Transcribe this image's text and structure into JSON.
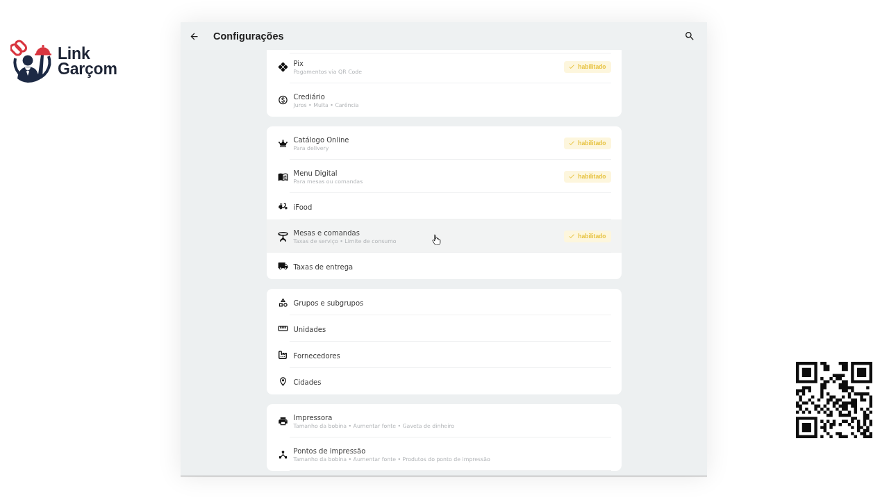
{
  "brand": {
    "name_lines": [
      "Link",
      "Garçom"
    ]
  },
  "header": {
    "title": "Configurações"
  },
  "sections": [
    {
      "rows": [
        {
          "title": "Pix",
          "subtitle": "Pagamentos via QR Code",
          "badge": "habilitado",
          "highlighted": false
        },
        {
          "title": "Crediário",
          "subtitle": "Juros • Multa • Carência",
          "highlighted": false
        }
      ]
    },
    {
      "rows": [
        {
          "title": "Catálogo Online",
          "subtitle": "Para delivery",
          "badge": "habilitado",
          "highlighted": false
        },
        {
          "title": "Menu Digital",
          "subtitle": "Para mesas ou comandas",
          "badge": "habilitado",
          "highlighted": false
        },
        {
          "title": "iFood",
          "highlighted": false
        },
        {
          "title": "Mesas e comandas",
          "subtitle": "Taxas de serviço • Limite de consumo",
          "badge": "habilitado",
          "highlighted": true
        },
        {
          "title": "Taxas de entrega",
          "highlighted": false
        }
      ]
    },
    {
      "rows": [
        {
          "title": "Grupos e subgrupos",
          "highlighted": false
        },
        {
          "title": "Unidades",
          "highlighted": false
        },
        {
          "title": "Fornecedores",
          "highlighted": false
        },
        {
          "title": "Cidades",
          "highlighted": false
        }
      ]
    },
    {
      "rows": [
        {
          "title": "Impressora",
          "subtitle": "Tamanho da bobina • Aumentar fonte • Gaveta de dinheiro",
          "highlighted": false
        },
        {
          "title": "Pontos de impressão",
          "subtitle": "Tamanho da bobina • Aumentar fonte • Produtos do ponto de impressão",
          "highlighted": false
        }
      ]
    }
  ]
}
